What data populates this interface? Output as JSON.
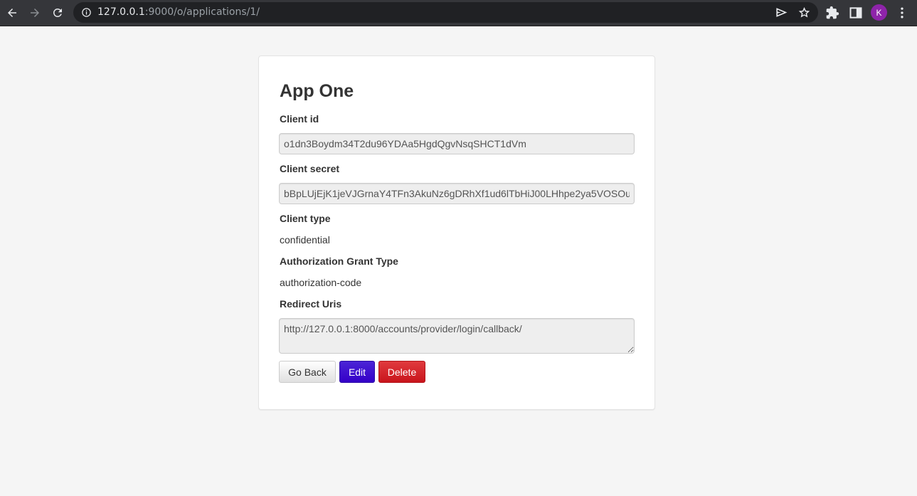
{
  "browser": {
    "url_host": "127.0.0.1",
    "url_rest": ":9000/o/applications/1/",
    "profile_initial": "K",
    "icons": [
      "back-arrow-icon",
      "forward-arrow-icon",
      "reload-icon",
      "info-icon",
      "send-icon",
      "star-icon",
      "extensions-icon",
      "side-panel-icon",
      "more-vert-icon"
    ],
    "colors": {
      "chrome": "#35363a",
      "omnibox": "#202124",
      "avatar": "#8e24aa"
    }
  },
  "app": {
    "name": "App One",
    "client_id_label": "Client id",
    "client_id": "o1dn3Boydm34T2du96YDAa5HgdQgvNsqSHCT1dVm",
    "client_secret_label": "Client secret",
    "client_secret": "bBpLUjEjK1jeVJGrnaY4TFn3AkuNz6gDRhXf1ud6lTbHiJ00LHhpe2ya5VOSOu",
    "client_type_label": "Client type",
    "client_type": "confidential",
    "grant_type_label": "Authorization Grant Type",
    "grant_type": "authorization-code",
    "redirect_uris_label": "Redirect Uris",
    "redirect_uris": "http://127.0.0.1:8000/accounts/provider/login/callback/"
  },
  "actions": {
    "go_back": "Go Back",
    "edit": "Edit",
    "delete": "Delete"
  },
  "colors": {
    "page_bg": "#f5f5f5",
    "primary": "#3500c8",
    "danger": "#c9151c"
  }
}
